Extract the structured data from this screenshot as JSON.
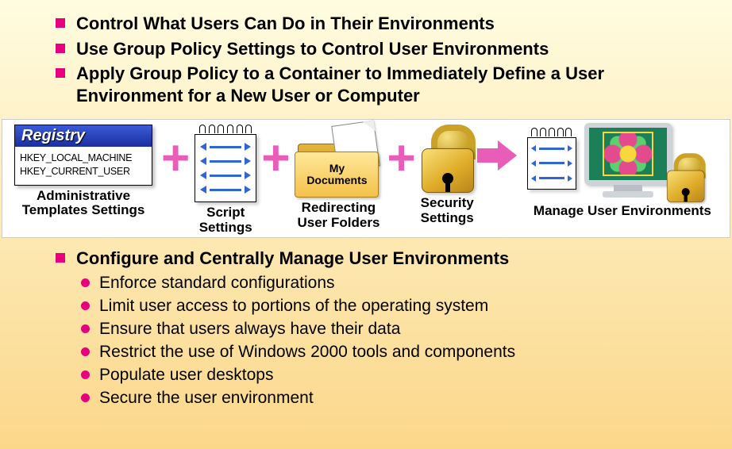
{
  "top_bullets": [
    "Control What Users Can Do in Their Environments",
    "Use Group Policy Settings to Control User Environments",
    "Apply Group Policy to a Container to Immediately Define a User Environment for a New User or Computer"
  ],
  "diagram": {
    "registry": {
      "title": "Registry",
      "line1": "HKEY_LOCAL_MACHINE",
      "line2": "HKEY_CURRENT_USER",
      "caption": "Administrative\nTemplates Settings"
    },
    "script": {
      "caption": "Script\nSettings"
    },
    "folder": {
      "label": "My\nDocuments",
      "caption": "Redirecting\nUser Folders"
    },
    "security": {
      "caption": "Security\nSettings"
    },
    "manage": {
      "caption": "Manage User Environments"
    }
  },
  "bottom_heading": "Configure and Centrally Manage User Environments",
  "sub_bullets": [
    "Enforce standard configurations",
    "Limit user access to portions of the operating system",
    "Ensure that users always have their data",
    "Restrict the use of Windows 2000 tools and components",
    "Populate user desktops",
    "Secure the user environment"
  ]
}
